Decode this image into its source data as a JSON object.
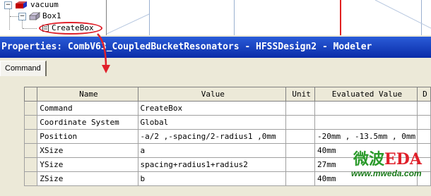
{
  "tree": {
    "items": [
      {
        "label": "vacuum",
        "expander": "−"
      },
      {
        "label": "Box1",
        "expander": "−"
      },
      {
        "label": "CreateBox",
        "expander": ""
      }
    ]
  },
  "window": {
    "title": "Properties: CombV63_CoupledBucketResonators - HFSSDesign2 - Modeler"
  },
  "tabs": [
    {
      "label": "Command",
      "selected": true
    }
  ],
  "grid": {
    "columns": [
      "Name",
      "Value",
      "Unit",
      "Evaluated Value",
      "D"
    ],
    "rows": [
      {
        "name": "Command",
        "value": "CreateBox",
        "unit": "",
        "evaluated": ""
      },
      {
        "name": "Coordinate System",
        "value": "Global",
        "unit": "",
        "evaluated": ""
      },
      {
        "name": "Position",
        "value": "-a/2 ,-spacing/2-radius1 ,0mm",
        "unit": "",
        "evaluated": "-20mm , -13.5mm , 0mm"
      },
      {
        "name": "XSize",
        "value": "a",
        "unit": "",
        "evaluated": "40mm"
      },
      {
        "name": "YSize",
        "value": "spacing+radius1+radius2",
        "unit": "",
        "evaluated": "27mm"
      },
      {
        "name": "ZSize",
        "value": "b",
        "unit": "",
        "evaluated": "40mm"
      }
    ]
  },
  "watermark": {
    "logo_part1": "微波",
    "logo_part2": "EDA",
    "url": "www.mweda.com"
  },
  "colors": {
    "titlebar_start": "#2a5cd8",
    "titlebar_end": "#0a2ca8",
    "callout": "#e0202a",
    "watermark_green": "#2a9a2a"
  }
}
